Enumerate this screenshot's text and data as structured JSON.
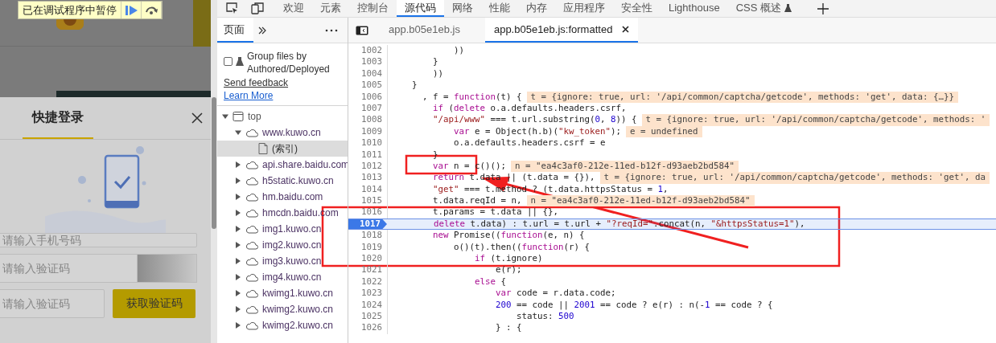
{
  "pause_banner": {
    "message": "已在调试程序中暂停"
  },
  "web_page": {
    "login_dialog": {
      "tabs": [
        {
          "label": "快捷登录",
          "selected": true
        }
      ],
      "fields": [
        {
          "kind": "text",
          "placeholder": "请输入手机号码"
        },
        {
          "kind": "captcha",
          "placeholder": "请输入验证码"
        },
        {
          "kind": "sms",
          "placeholder": "请输入验证码",
          "button": "获取验证码"
        }
      ]
    }
  },
  "devtools": {
    "tabs": [
      {
        "label": "欢迎",
        "selected": false,
        "experimental": false
      },
      {
        "label": "元素",
        "selected": false,
        "experimental": false
      },
      {
        "label": "控制台",
        "selected": false,
        "experimental": false
      },
      {
        "label": "源代码",
        "selected": true,
        "experimental": false
      },
      {
        "label": "网络",
        "selected": false,
        "experimental": false
      },
      {
        "label": "性能",
        "selected": false,
        "experimental": false
      },
      {
        "label": "内存",
        "selected": false,
        "experimental": false
      },
      {
        "label": "应用程序",
        "selected": false,
        "experimental": false
      },
      {
        "label": "安全性",
        "selected": false,
        "experimental": false
      },
      {
        "label": "Lighthouse",
        "selected": false,
        "experimental": false
      },
      {
        "label": "CSS 概述",
        "selected": false,
        "experimental": true
      }
    ],
    "navigator": {
      "tabs": [
        {
          "label": "页面",
          "selected": true
        }
      ],
      "group_files": {
        "label": "Group files by Authored/Deployed",
        "checked": false
      },
      "links": [
        "Send feedback",
        "Learn More"
      ],
      "tree": [
        {
          "label": "top",
          "kind": "frame",
          "selected": false,
          "expanded": true,
          "children": [
            {
              "label": "www.kuwo.cn",
              "kind": "domain",
              "selected": false,
              "expanded": true,
              "children": [
                {
                  "label": "(索引)",
                  "kind": "file",
                  "selected": true
                }
              ]
            },
            {
              "label": "api.share.baidu.com",
              "kind": "domain",
              "selected": false,
              "expanded": false
            },
            {
              "label": "h5static.kuwo.cn",
              "kind": "domain",
              "selected": false,
              "expanded": false
            },
            {
              "label": "hm.baidu.com",
              "kind": "domain",
              "selected": false,
              "expanded": false
            },
            {
              "label": "hmcdn.baidu.com",
              "kind": "domain",
              "selected": false,
              "expanded": false
            },
            {
              "label": "img1.kuwo.cn",
              "kind": "domain",
              "selected": false,
              "expanded": false
            },
            {
              "label": "img2.kuwo.cn",
              "kind": "domain",
              "selected": false,
              "expanded": false
            },
            {
              "label": "img3.kuwo.cn",
              "kind": "domain",
              "selected": false,
              "expanded": false
            },
            {
              "label": "img4.kuwo.cn",
              "kind": "domain",
              "selected": false,
              "expanded": false
            },
            {
              "label": "kwimg1.kuwo.cn",
              "kind": "domain",
              "selected": false,
              "expanded": false
            },
            {
              "label": "kwimg2.kuwo.cn",
              "kind": "domain",
              "selected": false,
              "expanded": false
            },
            {
              "label": "kwimg2.kuwo.cn",
              "kind": "domain",
              "selected": false,
              "expanded": false
            }
          ]
        }
      ]
    },
    "editor_tabs": [
      {
        "label": "app.b05e1eb.js",
        "selected": false,
        "closable": false
      },
      {
        "label": "app.b05e1eb.js:formatted",
        "selected": true,
        "closable": true
      }
    ],
    "code_lines": [
      {
        "number": "1002",
        "code": "            ))",
        "current": false
      },
      {
        "number": "1003",
        "code": "        }",
        "current": false
      },
      {
        "number": "1004",
        "code": "        ))",
        "current": false
      },
      {
        "number": "1005",
        "code": "    }",
        "current": false
      },
      {
        "number": "1006",
        "code": "      , f = function(t) {",
        "value": "t = {ignore: true, url: '/api/common/captcha/getcode', methods: 'get', data: {…}}",
        "current": false
      },
      {
        "number": "1007",
        "code": "        if (delete o.a.defaults.headers.csrf,",
        "current": false
      },
      {
        "number": "1008",
        "code": "        \"/api/www\" === t.url.substring(0, 8)) {",
        "value": "t = {ignore: true, url: '/api/common/captcha/getcode', methods: '",
        "current": false
      },
      {
        "number": "1009",
        "code": "            var e = Object(h.b)(\"kw_token\");",
        "value": "e = undefined",
        "current": false
      },
      {
        "number": "1010",
        "code": "            o.a.defaults.headers.csrf = e",
        "current": false
      },
      {
        "number": "1011",
        "code": "        }",
        "current": false
      },
      {
        "number": "1012",
        "code": "        var n = c()();",
        "value": "n = \"ea4c3af0-212e-11ed-b12f-d93aeb2bd584\"",
        "current": false
      },
      {
        "number": "1013",
        "code": "        return t.data || (t.data = {}),",
        "value": "t = {ignore: true, url: '/api/common/captcha/getcode', methods: 'get', da",
        "current": false
      },
      {
        "number": "1014",
        "code": "        \"get\" === t.method ? (t.data.httpsStatus = 1,",
        "current": false
      },
      {
        "number": "1015",
        "code": "        t.data.reqId = n,",
        "value": "n = \"ea4c3af0-212e-11ed-b12f-d93aeb2bd584\"",
        "current": false
      },
      {
        "number": "1016",
        "code": "        t.params = t.data || {},",
        "current": false
      },
      {
        "number": "1017",
        "code": "        delete t.data) : t.url = t.url + \"?reqId=\".concat(n, \"&httpsStatus=1\"),",
        "current": true
      },
      {
        "number": "1018",
        "code": "        new Promise((function(e, n) {",
        "current": false
      },
      {
        "number": "1019",
        "code": "            o()(t).then((function(r) {",
        "current": false
      },
      {
        "number": "1020",
        "code": "                if (t.ignore)",
        "current": false
      },
      {
        "number": "1021",
        "code": "                    e(r);",
        "current": false
      },
      {
        "number": "1022",
        "code": "                else {",
        "current": false
      },
      {
        "number": "1023",
        "code": "                    var code = r.data.code;",
        "current": false
      },
      {
        "number": "1024",
        "code": "                    200 == code || 2001 == code ? e(r) : n(-1 == code ? {",
        "current": false
      },
      {
        "number": "1025",
        "code": "                        status: 500",
        "current": false
      },
      {
        "number": "1026",
        "code": "                    } : {",
        "current": false
      }
    ]
  }
}
